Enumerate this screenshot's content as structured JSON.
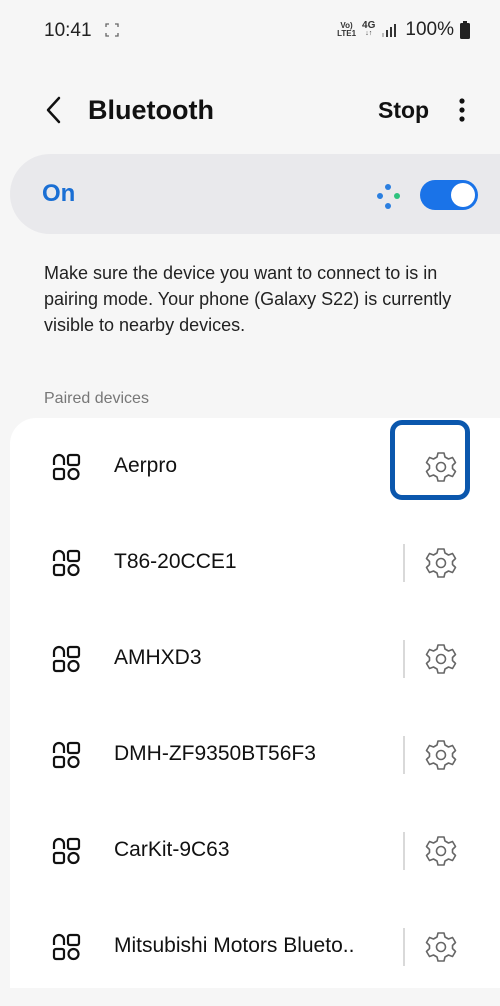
{
  "status_bar": {
    "time": "10:41",
    "network_top": "Vo)",
    "network_bottom": "LTE1",
    "network_type": "4G",
    "battery": "100%"
  },
  "header": {
    "title": "Bluetooth",
    "stop_label": "Stop"
  },
  "toggle": {
    "label": "On",
    "state": true,
    "accent_color": "#1a73e8"
  },
  "info_text": "Make sure the device you want to connect to is in pairing mode. Your phone (Galaxy S22) is currently visible to nearby devices.",
  "paired_section": {
    "header": "Paired devices",
    "devices": [
      {
        "name": "Aerpro"
      },
      {
        "name": "T86-20CCE1"
      },
      {
        "name": "AMHXD3"
      },
      {
        "name": "DMH-ZF9350BT56F3"
      },
      {
        "name": "CarKit-9C63"
      },
      {
        "name": "Mitsubishi Motors Blueto.."
      }
    ]
  }
}
